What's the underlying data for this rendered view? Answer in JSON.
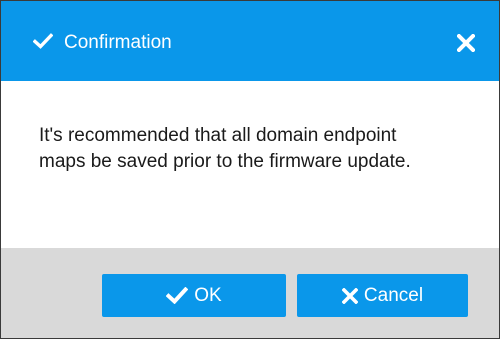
{
  "dialog": {
    "title": "Confirmation",
    "title_icon": "check-icon",
    "close_icon": "close-icon",
    "message": "It's recommended that all domain endpoint maps be saved prior to the firmware update."
  },
  "buttons": {
    "ok_label": "OK",
    "ok_icon": "check-icon",
    "cancel_label": "Cancel",
    "cancel_icon": "close-icon"
  },
  "colors": {
    "accent": "#0a97ea",
    "footer_bg": "#d9d9d9",
    "text": "#1a1a1a"
  }
}
